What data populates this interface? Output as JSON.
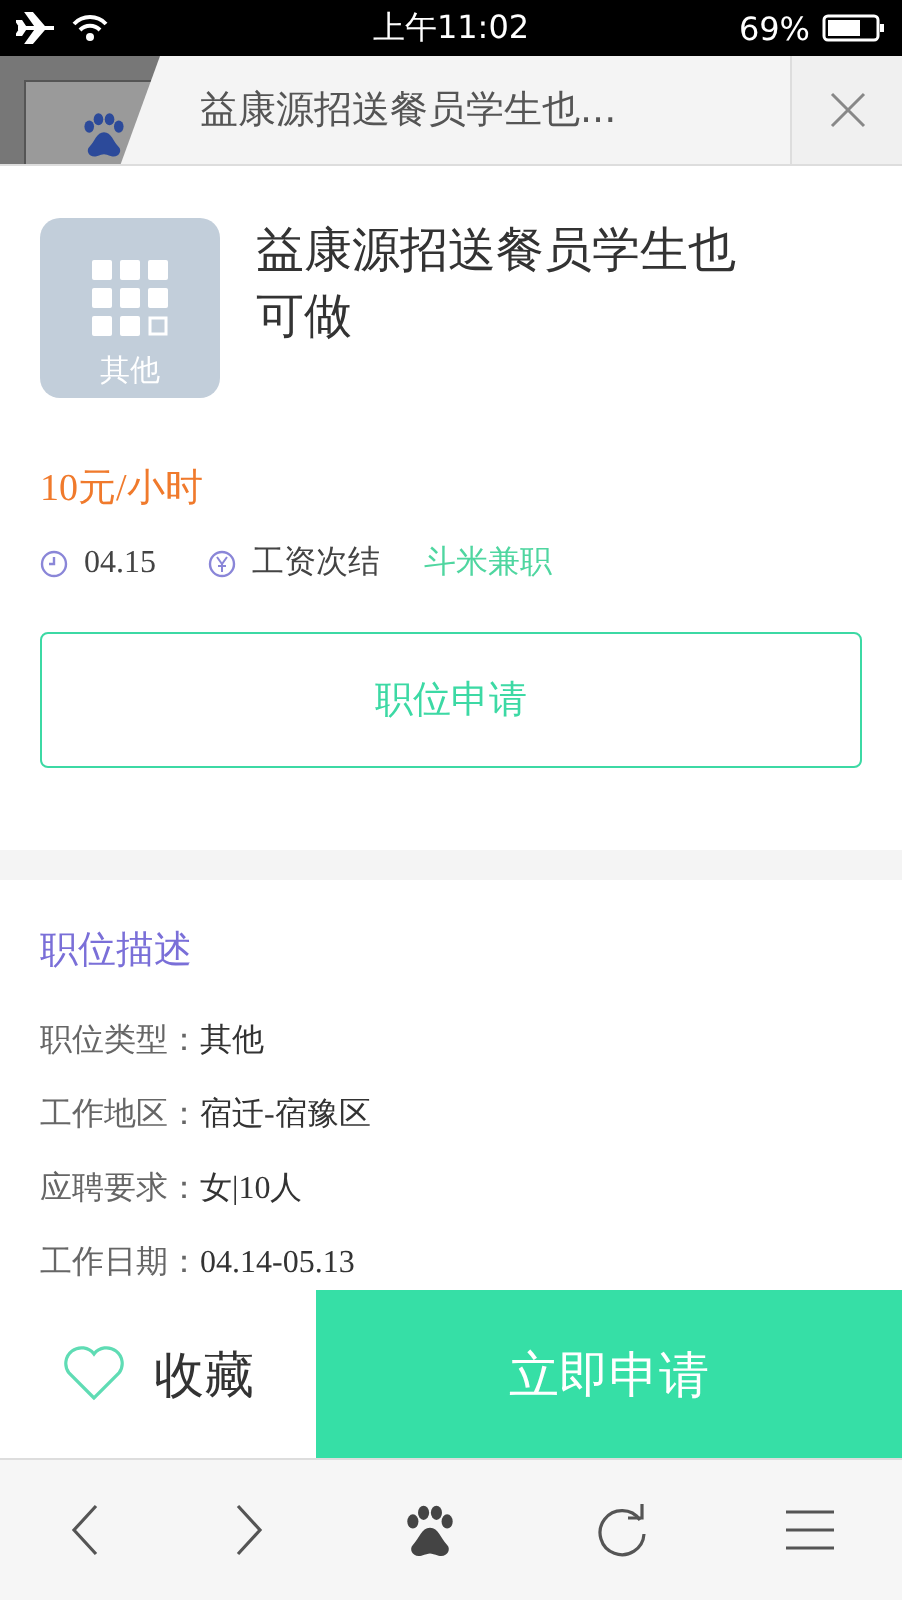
{
  "status_bar": {
    "time": "上午11:02",
    "battery": "69%"
  },
  "browser_tab": {
    "title": "益康源招送餐员学生也..."
  },
  "job": {
    "category": "其他",
    "title": "益康源招送餐员学生也可做",
    "salary": "10元/小时",
    "date": "04.15",
    "settlement": "工资次结",
    "source": "斗米兼职",
    "apply_button": "职位申请"
  },
  "description": {
    "heading": "职位描述",
    "fields": [
      {
        "label": "职位类型：",
        "value": "其他"
      },
      {
        "label": "工作地区：",
        "value": "宿迁-宿豫区"
      },
      {
        "label": "应聘要求：",
        "value": "女|10人"
      },
      {
        "label": "工作日期：",
        "value": "04.14-05.13"
      }
    ]
  },
  "action_bar": {
    "favorite": "收藏",
    "apply": "立即申请"
  }
}
